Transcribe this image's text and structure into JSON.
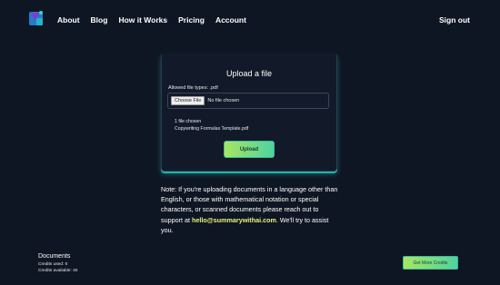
{
  "header": {
    "nav": [
      {
        "label": "About"
      },
      {
        "label": "Blog"
      },
      {
        "label": "How it Works"
      },
      {
        "label": "Pricing"
      },
      {
        "label": "Account"
      }
    ],
    "signout_label": "Sign out",
    "logo_icon": "brand-logo-icon"
  },
  "upload": {
    "title": "Upload a file",
    "allowed_types": "Allowed file types: .pdf",
    "choose_button": "Choose File",
    "no_file": "No file chosen",
    "chosen_count": "1 file chosen",
    "chosen_name": "Copywriting Formulas Template.pdf",
    "upload_button": "Upload"
  },
  "note": {
    "text_before": "Note: If you're uploading documents in a language other than English, or those with mathematical notation or special characters, or scanned documents please reach out to support at ",
    "email": "hello@summarywithai.com",
    "text_after": ". We'll try to assist you."
  },
  "documents": {
    "title": "Documents",
    "credits_used": "Credits used: 0",
    "credits_available": "Credits available: 40",
    "get_credits_button": "Get More Credits"
  },
  "colors": {
    "background": "#0f1623",
    "accent_teal": "#1fb3ae",
    "button_gradient_start": "#a6e761",
    "button_gradient_end": "#4fd39e",
    "email_highlight": "#e9f27a"
  }
}
